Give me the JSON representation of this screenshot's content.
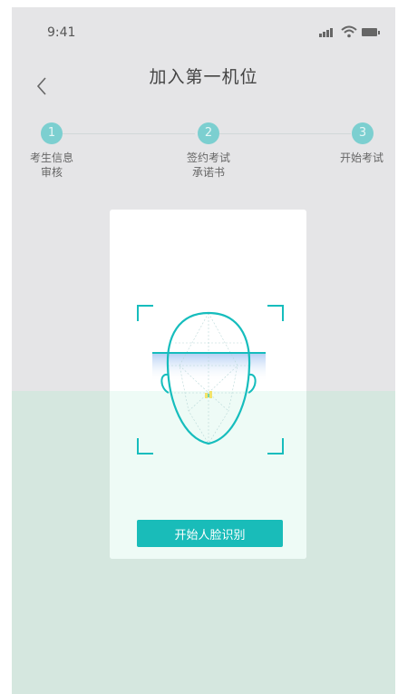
{
  "status_bar": {
    "time": "9:41",
    "icons": [
      "signal-icon",
      "wifi-icon",
      "battery-icon"
    ]
  },
  "header": {
    "title": "加入第一机位",
    "back_icon": "chevron-left-icon"
  },
  "steps": [
    {
      "number": "1",
      "line1": "考生信息",
      "line2": "审核"
    },
    {
      "number": "2",
      "line1": "签约考试",
      "line2": "承诺书"
    },
    {
      "number": "3",
      "line1": "开始考试",
      "line2": ""
    }
  ],
  "card": {
    "illustration": "face-scan-icon",
    "button_label": "开始人脸识别"
  },
  "colors": {
    "accent": "#19bcb9",
    "step": "#7ccfd0",
    "background": "#e5e5e7",
    "bottom_tint": "#d5e7df"
  }
}
